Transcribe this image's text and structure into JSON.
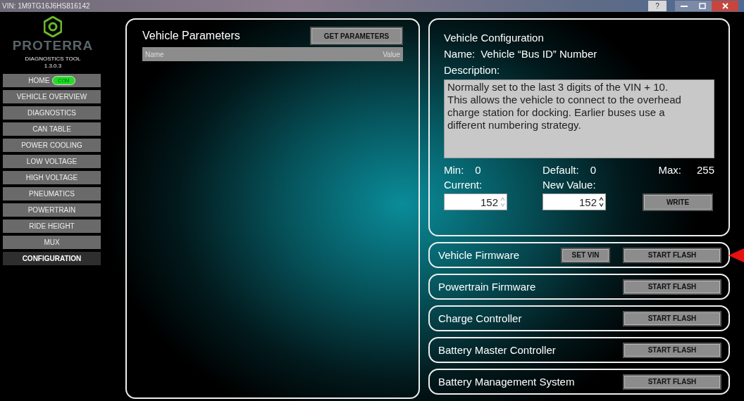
{
  "title_bar": {
    "title": "VIN: 1M9TG16J6HS816142",
    "help": "?"
  },
  "sidebar": {
    "brand": "PROTERRA",
    "subtitle": "DIAGNOSTICS TOOL",
    "version": "1.3.0.3",
    "items": [
      {
        "label": "HOME",
        "selected": false,
        "badge": {
          "text": "COM",
          "on": true
        }
      },
      {
        "label": "VEHICLE OVERVIEW",
        "selected": false
      },
      {
        "label": "DIAGNOSTICS",
        "selected": false
      },
      {
        "label": "CAN TABLE",
        "selected": false
      },
      {
        "label": "POWER COOLING",
        "selected": false
      },
      {
        "label": "LOW VOLTAGE",
        "selected": false
      },
      {
        "label": "HIGH VOLTAGE",
        "selected": false
      },
      {
        "label": "PNEUMATICS",
        "selected": false
      },
      {
        "label": "POWERTRAIN",
        "selected": false
      },
      {
        "label": "RIDE HEIGHT",
        "selected": false
      },
      {
        "label": "MUX",
        "selected": false
      },
      {
        "label": "CONFIGURATION",
        "selected": true
      }
    ]
  },
  "parameters": {
    "title": "Vehicle Parameters",
    "button": "GET PARAMETERS",
    "columns": [
      "Name",
      "Value"
    ]
  },
  "configuration": {
    "title": "Vehicle Configuration",
    "name_label": "Name:",
    "name": "Vehicle “Bus ID” Number",
    "description_label": "Description:",
    "description": "Normally set to the last 3 digits of the VIN + 10. This allows the vehicle to connect to the overhead charge station for docking.  Earlier buses use a different numbering strategy.",
    "min_label": "Min:",
    "min": "0",
    "default_label": "Default:",
    "default": "0",
    "max_label": "Max:",
    "max": "255",
    "current_label": "Current:",
    "current": {
      "value": "152",
      "disabled": true
    },
    "new_label": "New Value:",
    "new_value": {
      "value": "152",
      "disabled": false
    },
    "write_button": "WRITE"
  },
  "firmware": [
    {
      "name": "Vehicle Firmware",
      "buttons": [
        "SET VIN",
        "START FLASH"
      ],
      "pointer": true
    },
    {
      "name": "Powertrain Firmware",
      "buttons": [
        "START FLASH"
      ],
      "pointer": false
    },
    {
      "name": "Charge Controller",
      "buttons": [
        "START FLASH"
      ],
      "pointer": false
    },
    {
      "name": "Battery Master Controller",
      "buttons": [
        "START FLASH"
      ],
      "pointer": false
    },
    {
      "name": "Battery Management System",
      "buttons": [
        "START FLASH"
      ],
      "pointer": false
    }
  ]
}
